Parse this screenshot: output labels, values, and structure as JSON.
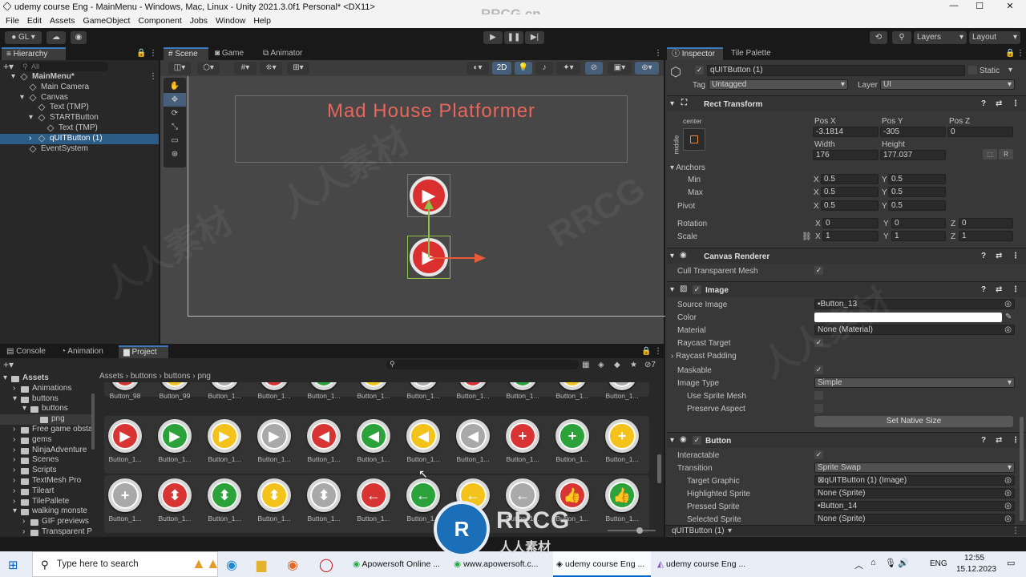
{
  "window": {
    "title": "udemy course Eng - MainMenu - Windows, Mac, Linux - Unity 2021.3.0f1 Personal* <DX11>",
    "watermark_top": "RRCG.cn"
  },
  "menu": [
    "File",
    "Edit",
    "Assets",
    "GameObject",
    "Component",
    "Jobs",
    "Window",
    "Help"
  ],
  "toolbar": {
    "account": "GL",
    "layers": "Layers",
    "layout": "Layout"
  },
  "hierarchy": {
    "tab": "Hierarchy",
    "search_placeholder": "All",
    "items": [
      {
        "label": "MainMenu*",
        "depth": 0
      },
      {
        "label": "Main Camera",
        "depth": 1
      },
      {
        "label": "Canvas",
        "depth": 1
      },
      {
        "label": "Text (TMP)",
        "depth": 2
      },
      {
        "label": "STARTButton",
        "depth": 2
      },
      {
        "label": "Text (TMP)",
        "depth": 3
      },
      {
        "label": "qUITButton (1)",
        "depth": 2
      },
      {
        "label": "EventSystem",
        "depth": 1
      }
    ]
  },
  "scene": {
    "tabs": [
      "Scene",
      "Game",
      "Animator"
    ],
    "title_text": "Mad House Platformer",
    "mode_2d": "2D",
    "colors": {
      "title": "#e8665c",
      "button_red": "#d9302f"
    }
  },
  "bottom": {
    "tabs": [
      "Console",
      "Animation",
      "Project"
    ],
    "breadcrumb": [
      "Assets",
      "buttons",
      "buttons",
      "png"
    ],
    "tree": [
      {
        "label": "Assets",
        "depth": 0
      },
      {
        "label": "Animations",
        "depth": 1
      },
      {
        "label": "buttons",
        "depth": 1
      },
      {
        "label": "buttons",
        "depth": 2
      },
      {
        "label": "png",
        "depth": 3
      },
      {
        "label": "Free game obsta",
        "depth": 1
      },
      {
        "label": "gems",
        "depth": 1
      },
      {
        "label": "NinjaAdventure",
        "depth": 1
      },
      {
        "label": "Scenes",
        "depth": 1
      },
      {
        "label": "Scripts",
        "depth": 1
      },
      {
        "label": "TextMesh Pro",
        "depth": 1
      },
      {
        "label": "Tileart",
        "depth": 1
      },
      {
        "label": "TilePallete",
        "depth": 1
      },
      {
        "label": "walking monste",
        "depth": 1
      },
      {
        "label": "GIF previews",
        "depth": 2
      },
      {
        "label": "Transparent P",
        "depth": 2
      }
    ],
    "row1_labels": [
      "Button_98",
      "Button_99",
      "Button_1...",
      "Button_1...",
      "Button_1...",
      "Button_1...",
      "Button_1...",
      "Button_1...",
      "Button_1...",
      "Button_1...",
      "Button_1..."
    ],
    "row2": [
      {
        "label": "Button_1...",
        "color": "#d93434",
        "glyph": "▶"
      },
      {
        "label": "Button_1...",
        "color": "#2ca23a",
        "glyph": "▶"
      },
      {
        "label": "Button_1...",
        "color": "#f3c21b",
        "glyph": "▶"
      },
      {
        "label": "Button_1...",
        "color": "#a9a9a9",
        "glyph": "▶"
      },
      {
        "label": "Button_1...",
        "color": "#d93434",
        "glyph": "◀"
      },
      {
        "label": "Button_1...",
        "color": "#2ca23a",
        "glyph": "◀"
      },
      {
        "label": "Button_1...",
        "color": "#f3c21b",
        "glyph": "◀"
      },
      {
        "label": "Button_1...",
        "color": "#a9a9a9",
        "glyph": "◀"
      },
      {
        "label": "Button_1...",
        "color": "#d93434",
        "glyph": "+"
      },
      {
        "label": "Button_1...",
        "color": "#2ca23a",
        "glyph": "+"
      },
      {
        "label": "Button_1...",
        "color": "#f3c21b",
        "glyph": "+"
      }
    ],
    "row3": [
      {
        "label": "Button_1...",
        "color": "#a9a9a9",
        "glyph": "+"
      },
      {
        "label": "Button_1...",
        "color": "#d93434",
        "glyph": "⬍"
      },
      {
        "label": "Button_1...",
        "color": "#2ca23a",
        "glyph": "⬍"
      },
      {
        "label": "Button_1...",
        "color": "#f3c21b",
        "glyph": "⬍"
      },
      {
        "label": "Button_1...",
        "color": "#a9a9a9",
        "glyph": "⬍"
      },
      {
        "label": "Button_1...",
        "color": "#d93434",
        "glyph": "←"
      },
      {
        "label": "Button_1...",
        "color": "#2ca23a",
        "glyph": "←"
      },
      {
        "label": "Button_1...",
        "color": "#f3c21b",
        "glyph": "←"
      },
      {
        "label": "Button_1...",
        "color": "#a9a9a9",
        "glyph": "←"
      },
      {
        "label": "Button_1...",
        "color": "#d93434",
        "glyph": "👍"
      },
      {
        "label": "Button_1...",
        "color": "#2ca23a",
        "glyph": "👍"
      }
    ]
  },
  "inspector": {
    "tabs": [
      "Inspector",
      "Tile Palette"
    ],
    "object_name": "qUITButton (1)",
    "static_label": "Static",
    "tag_label": "Tag",
    "tag_value": "Untagged",
    "layer_label": "Layer",
    "layer_value": "UI",
    "rect": {
      "title": "Rect Transform",
      "anchor_preset": "center",
      "anchor_side": "middle",
      "posx_label": "Pos X",
      "posy_label": "Pos Y",
      "posz_label": "Pos Z",
      "posx": "-3.1814",
      "posy": "-305",
      "posz": "0",
      "width_label": "Width",
      "height_label": "Height",
      "width": "176",
      "height": "177.037",
      "anchors": "Anchors",
      "min": "Min",
      "max": "Max",
      "pivot": "Pivot",
      "min_x": "0.5",
      "min_y": "0.5",
      "max_x": "0.5",
      "max_y": "0.5",
      "pivot_x": "0.5",
      "pivot_y": "0.5",
      "rotation": "Rotation",
      "scale": "Scale",
      "rot_x": "0",
      "rot_y": "0",
      "rot_z": "0",
      "scale_x": "1",
      "scale_y": "1",
      "scale_z": "1",
      "x": "X",
      "y": "Y",
      "z": "Z"
    },
    "canvas_renderer": {
      "title": "Canvas Renderer",
      "cull": "Cull Transparent Mesh"
    },
    "image": {
      "title": "Image",
      "source_label": "Source Image",
      "source": "Button_13",
      "color_label": "Color",
      "color": "#ffffff",
      "material_label": "Material",
      "material": "None (Material)",
      "raycast_target": "Raycast Target",
      "raycast_padding": "Raycast Padding",
      "maskable": "Maskable",
      "type_label": "Image Type",
      "type": "Simple",
      "use_sprite_mesh": "Use Sprite Mesh",
      "preserve_aspect": "Preserve Aspect",
      "native_size": "Set Native Size"
    },
    "button": {
      "title": "Button",
      "interactable": "Interactable",
      "transition_label": "Transition",
      "transition": "Sprite Swap",
      "target_label": "Target Graphic",
      "target": "qUITButton (1) (Image)",
      "highlighted_label": "Highlighted Sprite",
      "highlighted": "None (Sprite)",
      "pressed_label": "Pressed Sprite",
      "pressed": "Button_14",
      "selected_label": "Selected Sprite",
      "selected": "None (Sprite)"
    },
    "footer": "qUITButton (1)"
  },
  "taskbar": {
    "search_placeholder": "Type here to search",
    "apps": [
      "Apowersoft Online ...",
      "www.apowersoft.c...",
      "udemy course Eng ...",
      "udemy course Eng ..."
    ],
    "lang": "ENG",
    "time": "12:55",
    "date": "15.12.2023"
  }
}
